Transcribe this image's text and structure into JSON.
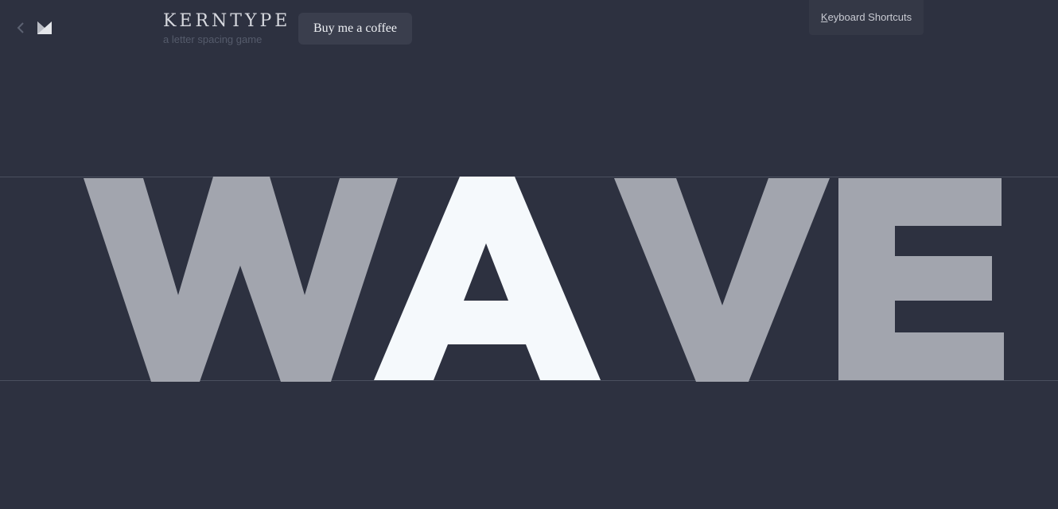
{
  "header": {
    "title": "KERNTYPE",
    "subtitle": "a letter spacing game",
    "coffee_label": "Buy me a coffee",
    "shortcuts_accel": "K",
    "shortcuts_rest": "eyboard Shortcuts"
  },
  "puzzle": {
    "word": "WAVE",
    "letters": [
      {
        "char": "W",
        "state": "fixed"
      },
      {
        "char": "A",
        "state": "selected"
      },
      {
        "char": "V",
        "state": "fixed"
      },
      {
        "char": "E",
        "state": "fixed"
      }
    ]
  },
  "colors": {
    "background": "#2d3140",
    "letter_fixed": "#a2a5ae",
    "letter_selected": "#f5f9fc",
    "guide_line": "#4a4f5e"
  },
  "icons": {
    "back": "chevron-left-icon",
    "logo": "kerntype-logo-icon"
  }
}
